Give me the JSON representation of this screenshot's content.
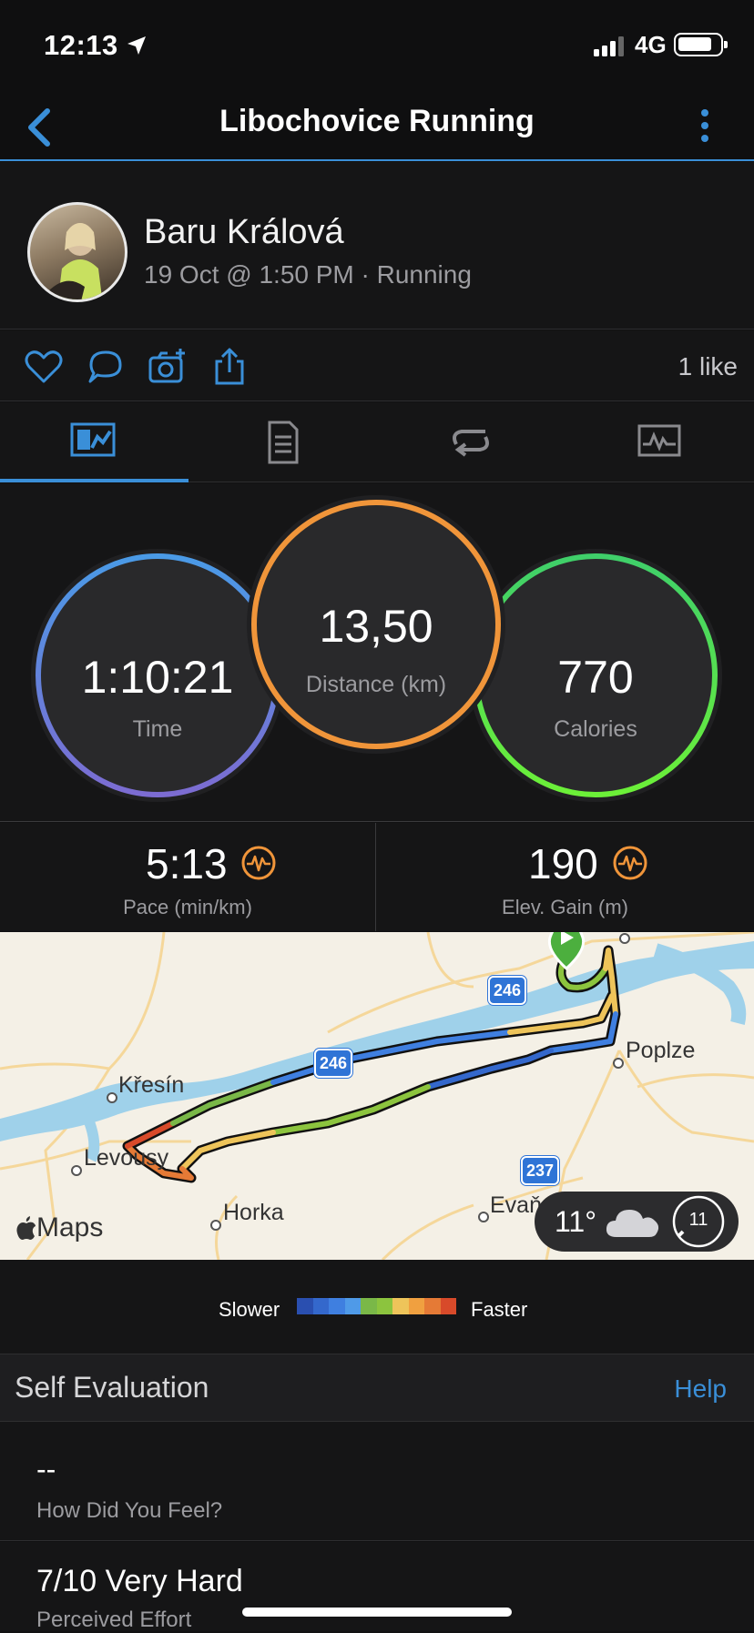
{
  "status_bar": {
    "time": "12:13",
    "network": "4G"
  },
  "header": {
    "title": "Libochovice Running"
  },
  "profile": {
    "name": "Baru Králová",
    "meta": "19 Oct @ 1:50 PM · Running"
  },
  "actions": {
    "likes": "1 like"
  },
  "tabs": [
    {
      "name": "overview",
      "active": true
    },
    {
      "name": "details",
      "active": false
    },
    {
      "name": "laps",
      "active": false
    },
    {
      "name": "charts",
      "active": false
    }
  ],
  "stats": {
    "time": {
      "value": "1:10:21",
      "label": "Time"
    },
    "distance": {
      "value": "13,50",
      "label": "Distance (km)"
    },
    "calories": {
      "value": "770",
      "label": "Calories"
    },
    "pace": {
      "value": "5:13",
      "label": "Pace (min/km)"
    },
    "elevation": {
      "value": "190",
      "label": "Elev. Gain (m)"
    }
  },
  "map": {
    "attribution": "Maps",
    "places": {
      "kresin": "Křesín",
      "levousy": "Levousy",
      "horka": "Horka",
      "poplze": "Poplze",
      "evan": "Evaň"
    },
    "roads": {
      "r246a": "246",
      "r246b": "246",
      "r237": "237"
    },
    "weather": {
      "temp": "11°",
      "wind": "11"
    }
  },
  "legend": {
    "slower": "Slower",
    "faster": "Faster",
    "colors": [
      "#2a4fb0",
      "#3468cc",
      "#3f7fe0",
      "#4f9ae8",
      "#7ab848",
      "#8cc43e",
      "#eec45a",
      "#f0a040",
      "#e57a36",
      "#d84a2a"
    ]
  },
  "self_evaluation": {
    "title": "Self Evaluation",
    "help": "Help",
    "feel": {
      "value": "--",
      "label": "How Did You Feel?"
    },
    "effort": {
      "value": "7/10 Very Hard",
      "label": "Perceived Effort"
    }
  }
}
